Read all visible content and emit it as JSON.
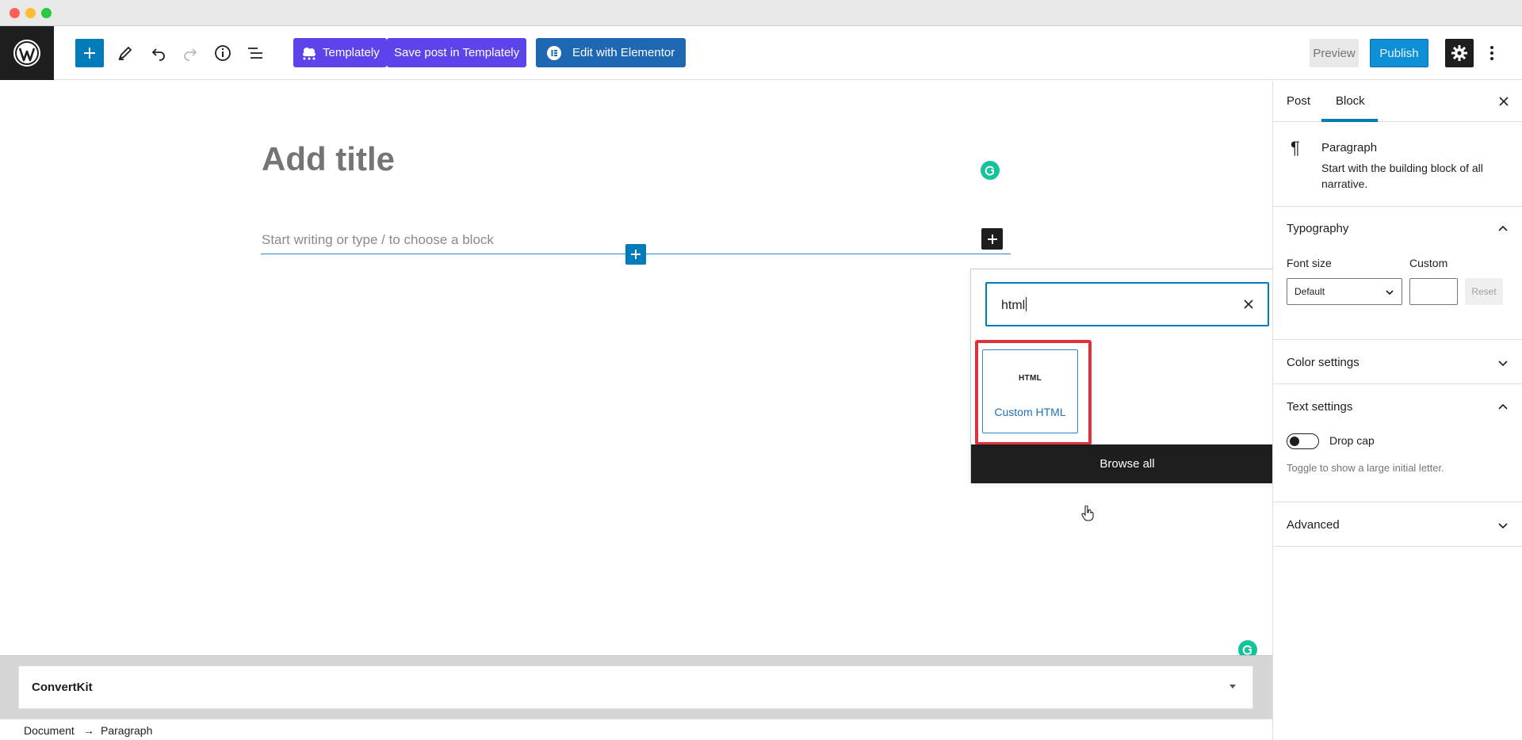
{
  "toolbar": {
    "templately_label": "Templately",
    "save_templately_label": "Save post in Templately",
    "elementor_label": "Edit with Elementor",
    "preview_label": "Preview",
    "publish_label": "Publish"
  },
  "editor": {
    "title_placeholder": "Add title",
    "paragraph_placeholder": "Start writing or type / to choose a block"
  },
  "inserter": {
    "search_value": "html",
    "result_icon_text": "HTML",
    "result_label": "Custom HTML",
    "browse_all_label": "Browse all"
  },
  "metabox": {
    "title": "ConvertKit"
  },
  "breadcrumb": {
    "items": [
      "Document",
      "Paragraph"
    ],
    "separator": "→"
  },
  "sidebar": {
    "tabs": [
      {
        "label": "Post",
        "active": false
      },
      {
        "label": "Block",
        "active": true
      }
    ],
    "block_card": {
      "title": "Paragraph",
      "description": "Start with the building block of all narrative."
    },
    "typography": {
      "title": "Typography",
      "font_size_label": "Font size",
      "custom_label": "Custom",
      "font_size_value": "Default",
      "reset_label": "Reset"
    },
    "color_settings_title": "Color settings",
    "text_settings": {
      "title": "Text settings",
      "drop_cap_label": "Drop cap",
      "help": "Toggle to show a large initial letter."
    },
    "advanced_title": "Advanced"
  },
  "colors": {
    "wp_blue": "#007cba",
    "templately_purple": "#5b45ea",
    "elementor_blue": "#1e67b3",
    "highlight_red": "#e0323c",
    "grammarly_green": "#15c39a"
  }
}
